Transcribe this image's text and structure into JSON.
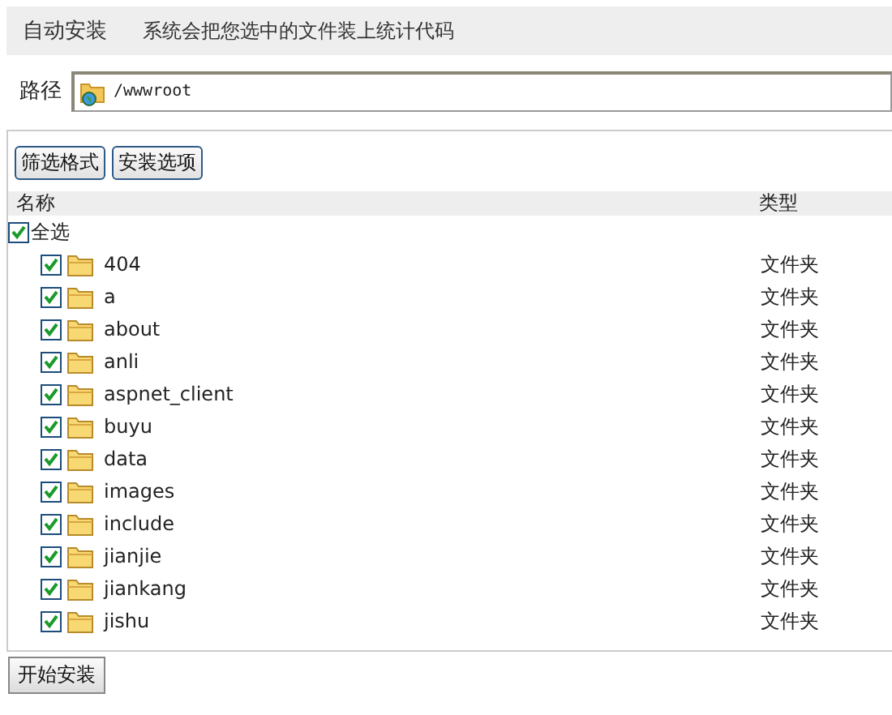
{
  "header": {
    "title": "自动安装",
    "description": "系统会把您选中的文件装上统计代码"
  },
  "path": {
    "label": "路径",
    "value": "/wwwroot"
  },
  "toolbar": [
    "筛选格式",
    "安装选项"
  ],
  "table": {
    "columns": [
      "名称",
      "类型"
    ],
    "select_all": {
      "label": "全选",
      "checked": true
    },
    "rows": [
      {
        "name": "404",
        "type": "文件夹",
        "checked": true
      },
      {
        "name": "a",
        "type": "文件夹",
        "checked": true
      },
      {
        "name": "about",
        "type": "文件夹",
        "checked": true
      },
      {
        "name": "anli",
        "type": "文件夹",
        "checked": true
      },
      {
        "name": "aspnet_client",
        "type": "文件夹",
        "checked": true
      },
      {
        "name": "buyu",
        "type": "文件夹",
        "checked": true
      },
      {
        "name": "data",
        "type": "文件夹",
        "checked": true
      },
      {
        "name": "images",
        "type": "文件夹",
        "checked": true
      },
      {
        "name": "include",
        "type": "文件夹",
        "checked": true
      },
      {
        "name": "jianjie",
        "type": "文件夹",
        "checked": true
      },
      {
        "name": "jiankang",
        "type": "文件夹",
        "checked": true
      },
      {
        "name": "jishu",
        "type": "文件夹",
        "checked": true
      }
    ]
  },
  "start_button": "开始安装"
}
